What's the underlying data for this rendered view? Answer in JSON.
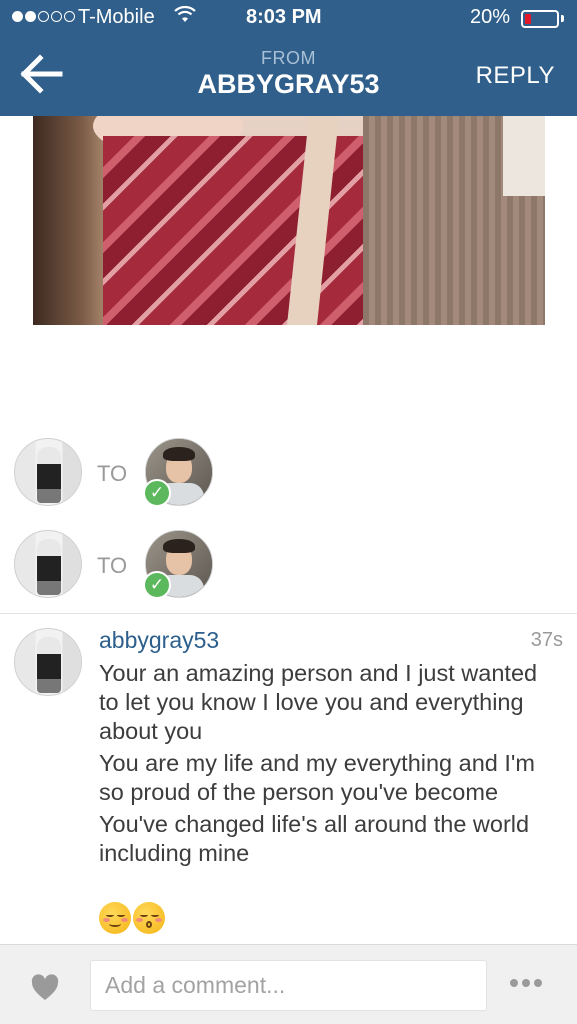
{
  "status_bar": {
    "carrier": "T-Mobile",
    "time": "8:03 PM",
    "battery_percent": "20%",
    "battery_level": 0.2,
    "signal_bars_filled": 2,
    "signal_bars_total": 5
  },
  "nav": {
    "back_icon": "arrow-left-icon",
    "from_label": "FROM",
    "title": "ABBYGRAY53",
    "reply_label": "REPLY"
  },
  "recipients": [
    {
      "to_label": "TO"
    },
    {
      "to_label": "TO"
    }
  ],
  "comment": {
    "username": "abbygray53",
    "time_ago": "37s",
    "lines": [
      "Your an amazing person and I just wanted to let you know I love you and everything about you",
      "You are my life and my everything and I'm so proud of the person you've become",
      "You've changed life's all around the world including mine"
    ],
    "emojis": [
      "relieved-face",
      "kissing-face-closed-eyes"
    ]
  },
  "bottom_bar": {
    "like_icon": "heart-icon",
    "input_placeholder": "Add a comment...",
    "more_icon": "more-dots-icon"
  },
  "colors": {
    "nav_bg": "#2f5f8a",
    "username": "#2d5f8d",
    "verified": "#5cb85c",
    "battery_low": "#e4182b"
  }
}
